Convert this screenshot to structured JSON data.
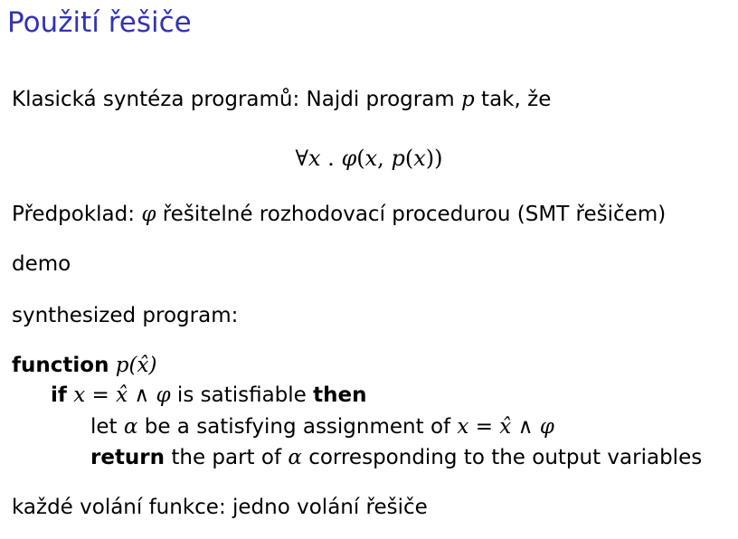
{
  "title": "Použití řešiče",
  "lines": {
    "classic": {
      "text": "Klasická syntéza programů: Najdi program ",
      "var_p": "p",
      "tail": " tak, že"
    },
    "formula": {
      "forall": "∀",
      "x": "x",
      "dot": " . ",
      "phi": "φ",
      "open": "(",
      "x2": "x",
      "comma": ", ",
      "p": "p",
      "open2": "(",
      "x3": "x",
      "close": "))"
    },
    "assumption": {
      "lead": "Předpoklad: ",
      "phi": "φ",
      "tail": " řešitelné rozhodovací procedurou (SMT řešičem)"
    },
    "demo": "demo",
    "synth": "synthesized program:",
    "func": {
      "keyword": "function",
      "space": " ",
      "p": "p",
      "args": "(x̂)"
    },
    "if_line": {
      "keyword": "if",
      "expr_x": "x",
      "expr_rest": " = x̂ ∧ φ",
      "middle": " is satisfiable ",
      "then": "then"
    },
    "let_line": {
      "lead": "let ",
      "alpha": "α",
      "middle": " be a satisfying assignment of ",
      "expr_x": "x",
      "expr_rest": " = x̂ ∧ φ"
    },
    "return_line": {
      "keyword": "return",
      "middle": " the part of ",
      "alpha": "α",
      "tail": " corresponding to the output variables"
    },
    "each_call": "každé volání funkce: jedno volání řešiče"
  },
  "colors": {
    "title": "#3333b3",
    "text": "#000000",
    "background": "#ffffff"
  }
}
